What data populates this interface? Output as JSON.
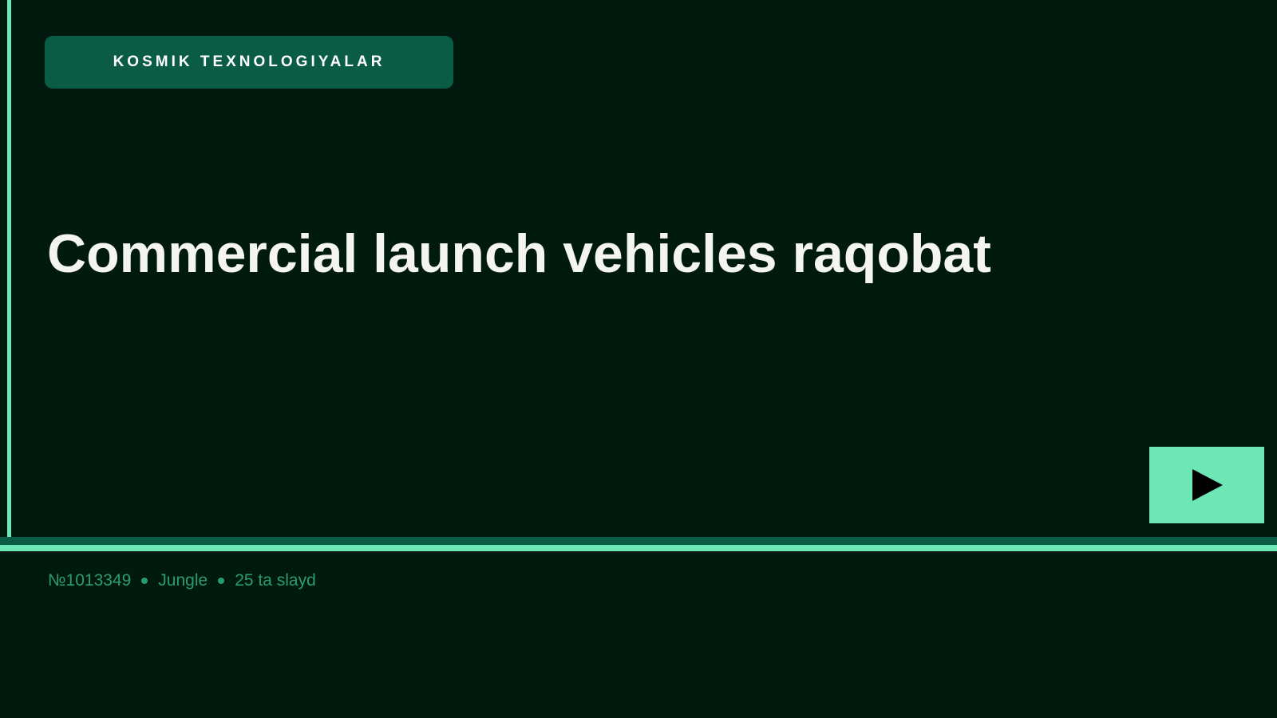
{
  "slide": {
    "category": "KOSMIK TEXNOLOGIYALAR",
    "title": "Commercial launch vehicles raqobat",
    "play_icon": "play-icon"
  },
  "footer": {
    "number": "№1013349",
    "theme": "Jungle",
    "slides": "25 ta slayd"
  },
  "colors": {
    "background": "#001a10",
    "accent_light": "#6ee7b7",
    "accent_dark": "#0a5c44",
    "title": "#f5f5f0",
    "meta_text": "#2a9d6f"
  }
}
